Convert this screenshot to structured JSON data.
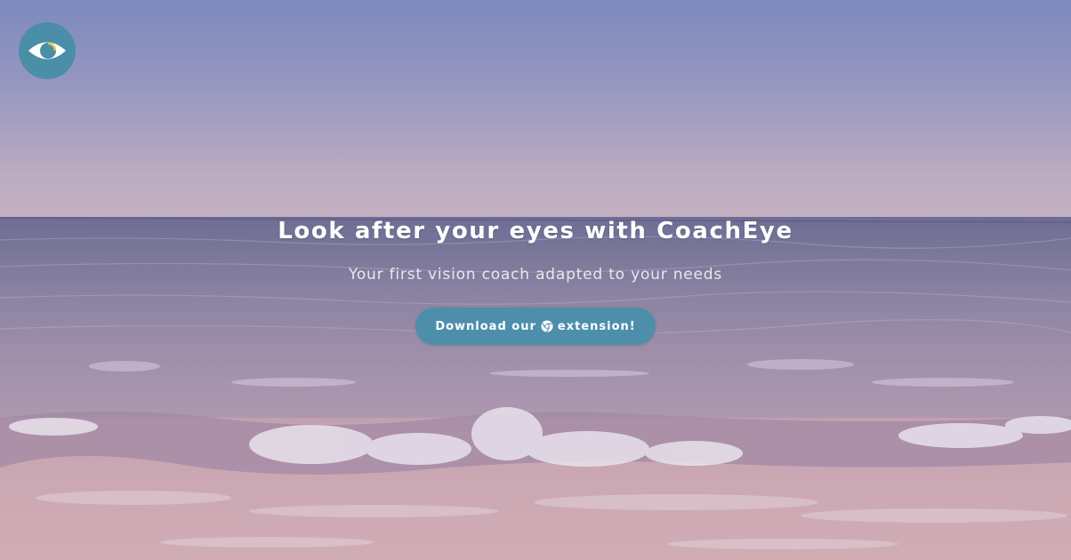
{
  "brand": {
    "logo_icon": "eye-icon",
    "accent_color": "#4a8ea8"
  },
  "hero": {
    "headline": "Look after your eyes with CoachEye",
    "subtitle": "Your first vision coach adapted to your needs",
    "cta": {
      "label_before": "Download our",
      "icon": "chrome-icon",
      "label_after": "extension!",
      "color": "#4d8fab"
    }
  }
}
